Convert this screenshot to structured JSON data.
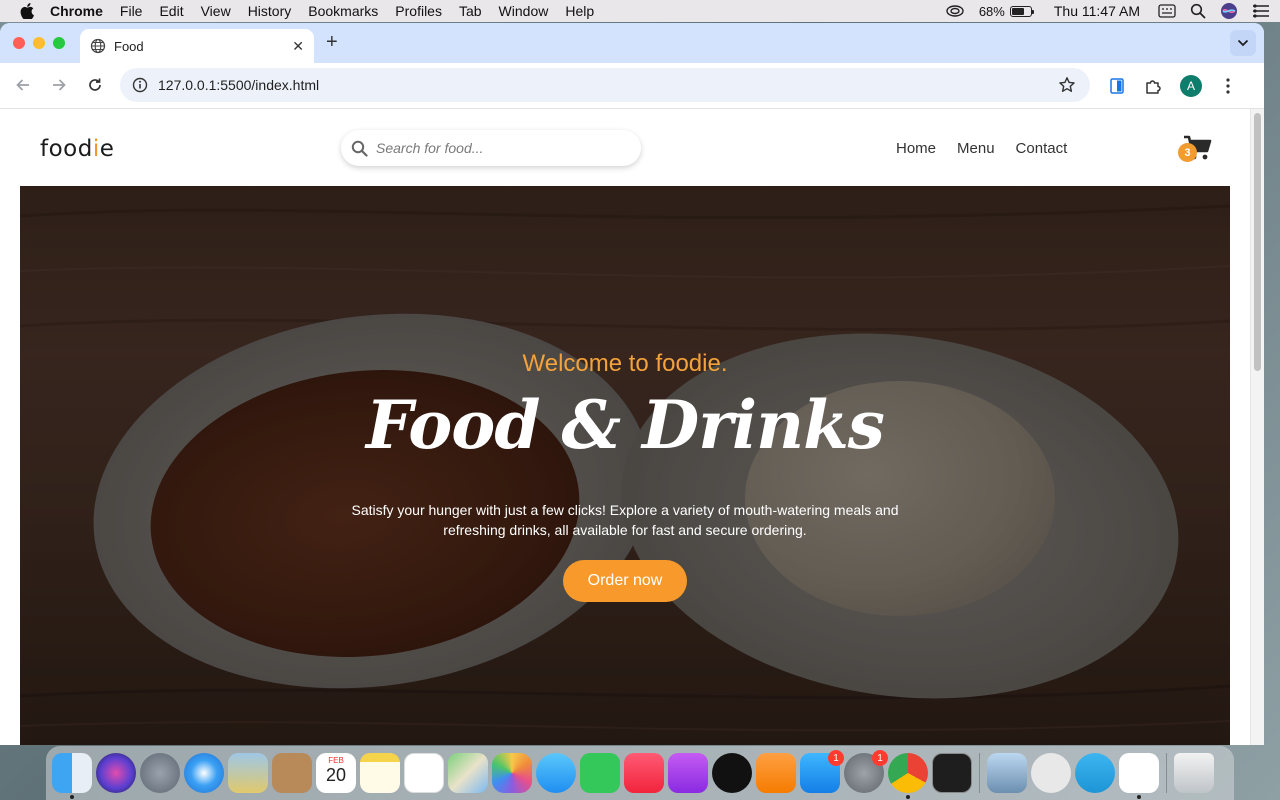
{
  "menubar": {
    "app_name": "Chrome",
    "items": [
      "File",
      "Edit",
      "View",
      "History",
      "Bookmarks",
      "Profiles",
      "Tab",
      "Window",
      "Help"
    ],
    "battery_percent": "68%",
    "battery_level": 0.68,
    "clock": "Thu 11:47 AM"
  },
  "browser": {
    "tab_title": "Food",
    "url": "127.0.0.1:5500/index.html",
    "profile_initial": "A"
  },
  "site": {
    "logo_start": "food",
    "logo_accent": "i",
    "logo_end": "e",
    "search_placeholder": "Search for food...",
    "nav": [
      "Home",
      "Menu",
      "Contact"
    ],
    "cart_count": "3",
    "accent_color": "#f79a2b"
  },
  "hero": {
    "welcome": "Welcome to foodie.",
    "title": "Food & Drinks",
    "description": "Satisfy your hunger with just a few clicks! Explore a variety of mouth-watering meals and refreshing drinks, all available for fast and secure ordering.",
    "cta_label": "Order now"
  },
  "dock": {
    "calendar_month": "FEB",
    "calendar_day": "20",
    "appstore_badge": "1",
    "settings_badge": "1"
  }
}
